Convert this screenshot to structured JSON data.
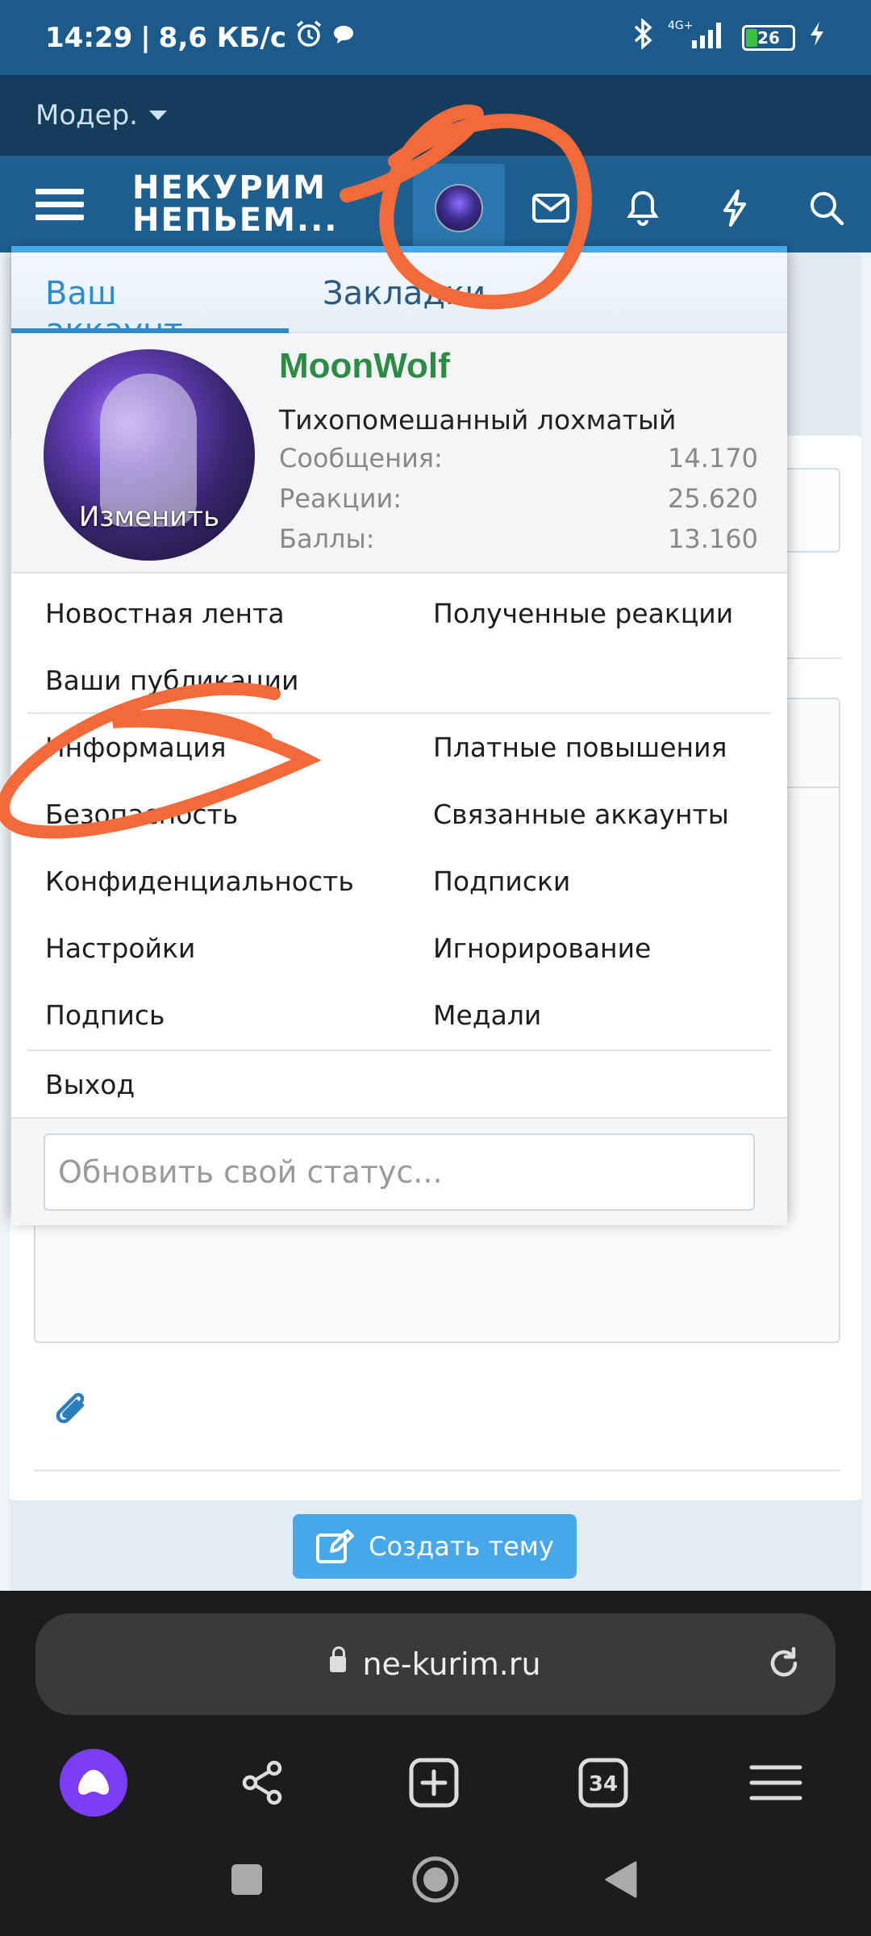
{
  "status_bar": {
    "time": "14:29",
    "separator": "|",
    "speed": "8,6 КБ/с",
    "battery": "26",
    "network": "4G+"
  },
  "moderator": {
    "label": "Модер."
  },
  "header": {
    "logo_line1": "НЕКУРИМ",
    "logo_line2": "НЕПЬЕМ..."
  },
  "menu": {
    "tabs": [
      "Ваш аккаунт",
      "Закладки"
    ],
    "user": {
      "name": "MoonWolf",
      "title": "Тихопомешанный лохматый",
      "avatar_edit": "Изменить",
      "stats": [
        {
          "label": "Сообщения:",
          "value": "14.170"
        },
        {
          "label": "Реакции:",
          "value": "25.620"
        },
        {
          "label": "Баллы:",
          "value": "13.160"
        }
      ]
    },
    "links_top": {
      "news_feed": "Новостная лента",
      "received_reactions": "Полученные реакции",
      "your_publications": "Ваши публикации"
    },
    "links_left": [
      "Информация",
      "Безопасность",
      "Конфиденциальность",
      "Настройки",
      "Подпись"
    ],
    "links_right": [
      "Платные повышения",
      "Связанные аккаунты",
      "Подписки",
      "Игнорирование",
      "Медали"
    ],
    "logout": "Выход",
    "status_placeholder": "Обновить свой статус..."
  },
  "page": {
    "create_topic": "Создать тему"
  },
  "browser": {
    "url": "ne-kurim.ru",
    "tabs_count": "34"
  },
  "colors": {
    "accent": "#47a7eb",
    "username": "#2e8b46",
    "header": "#1e5f90",
    "annotation": "#f26a3a"
  }
}
